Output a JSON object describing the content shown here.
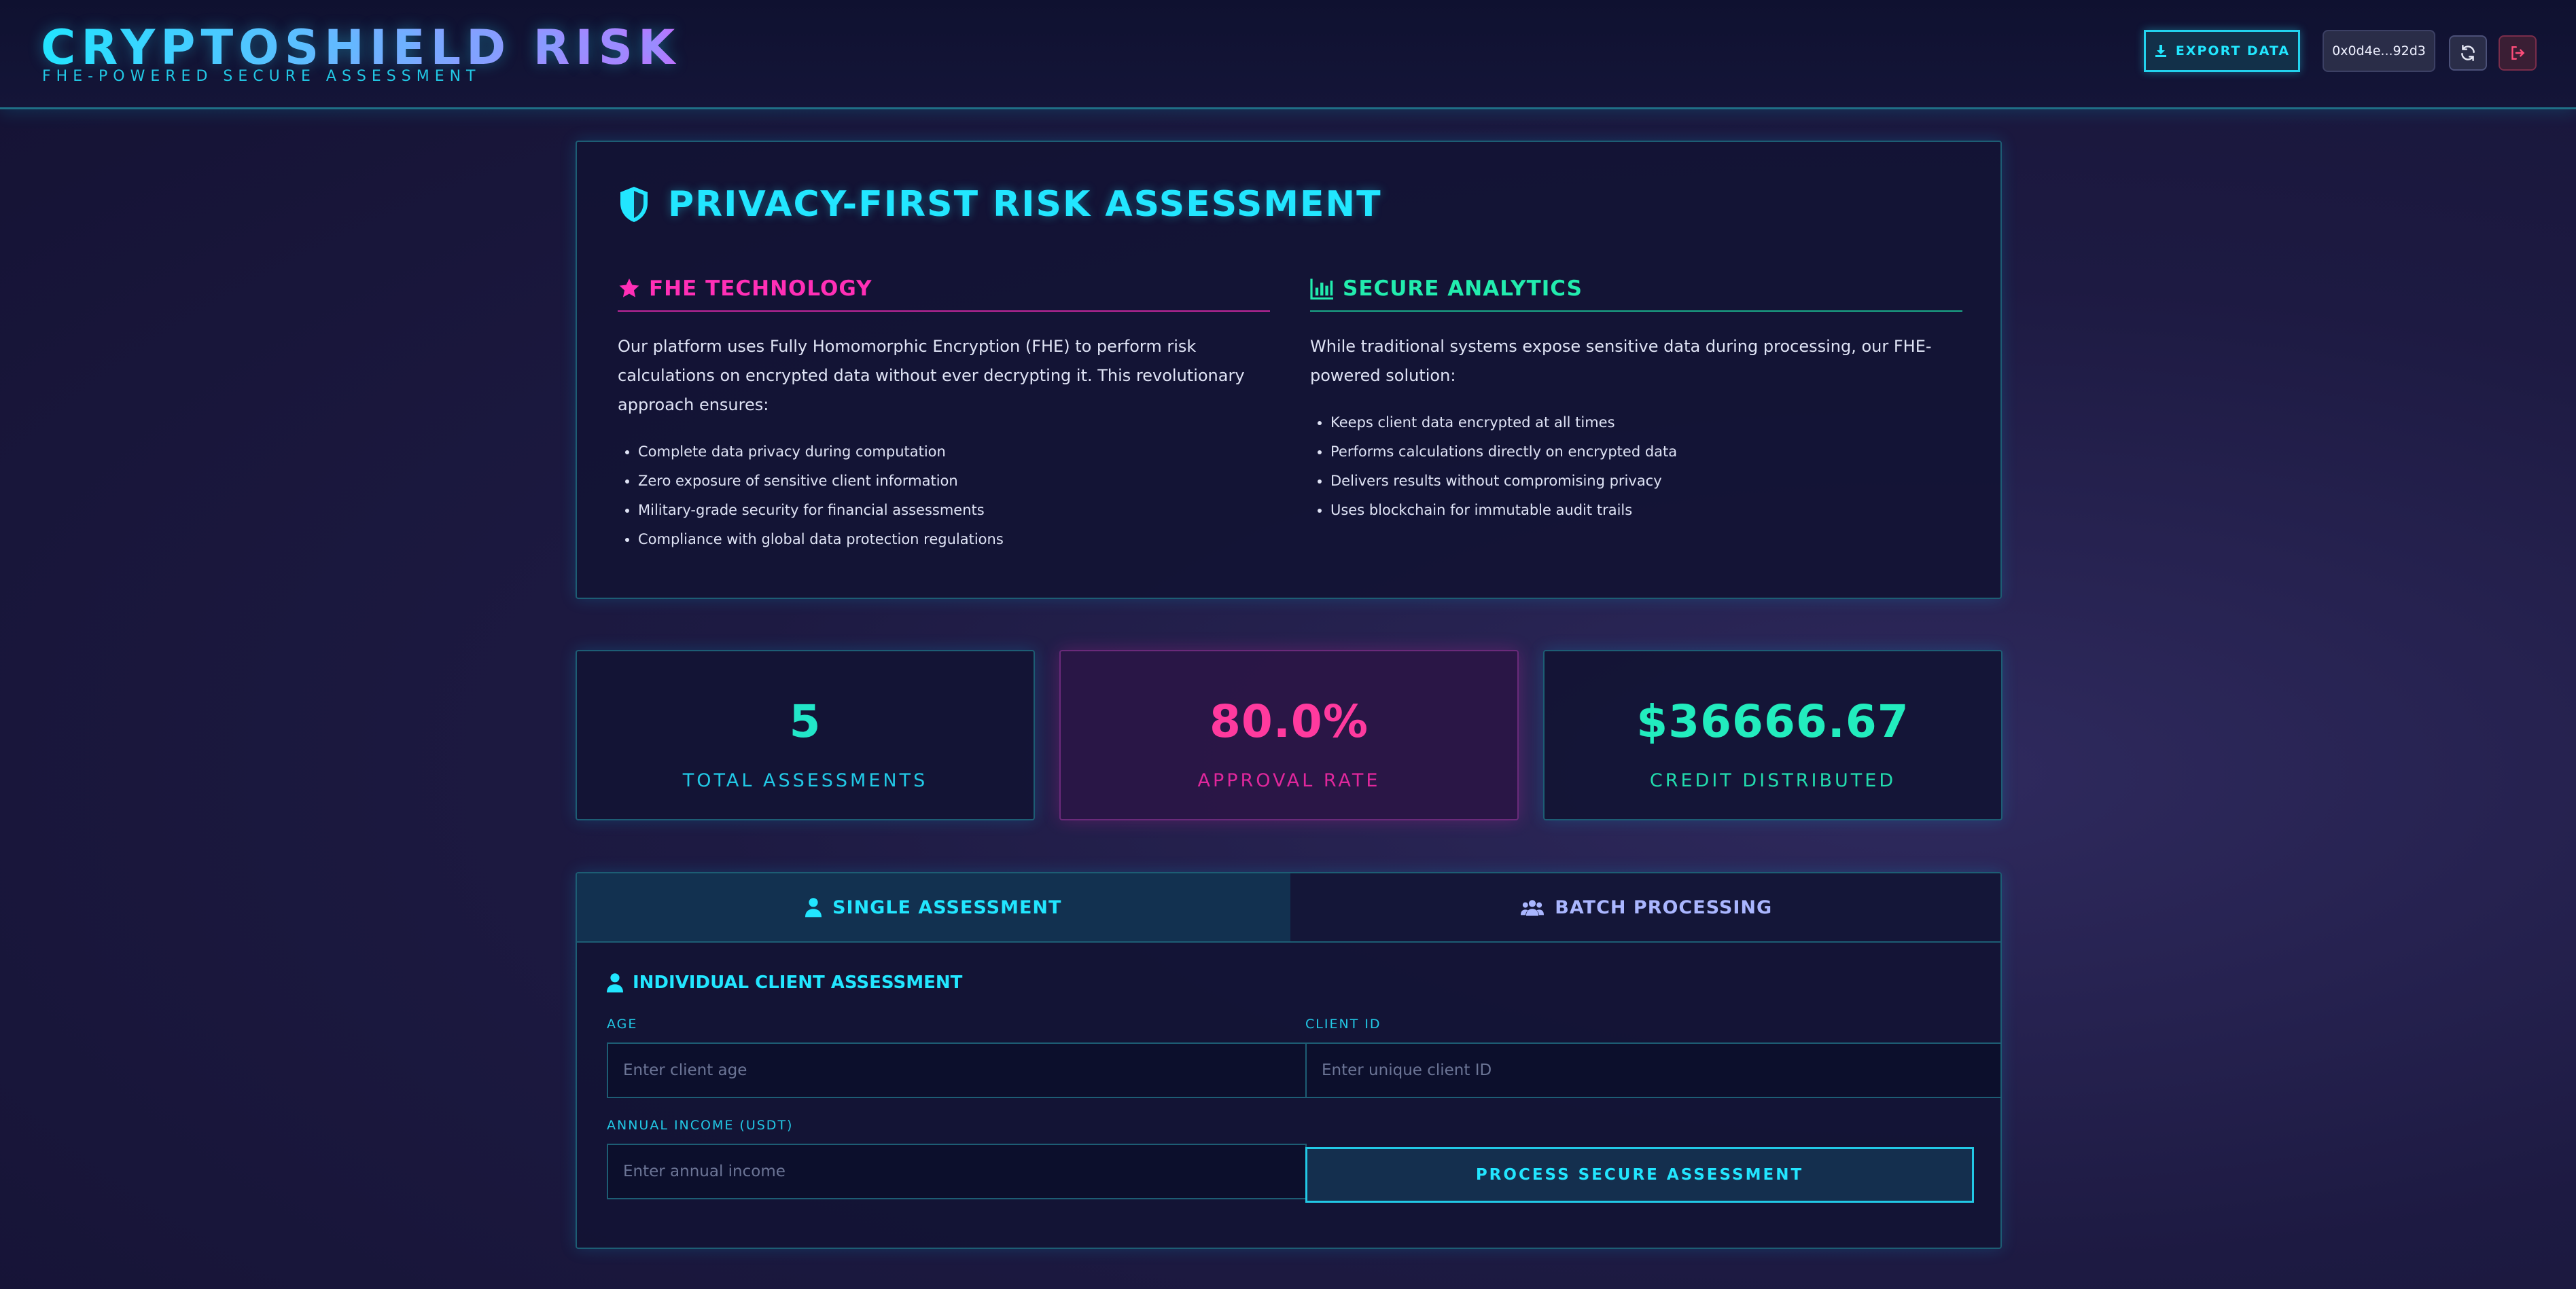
{
  "header": {
    "title": "CRYPTOSHIELD RISK",
    "tagline": "FHE-POWERED SECURE ASSESSMENT",
    "export_label": "EXPORT DATA",
    "wallet": "0x0d4e...92d3"
  },
  "intro": {
    "title": "PRIVACY-FIRST RISK ASSESSMENT",
    "fhe": {
      "heading": "FHE TECHNOLOGY",
      "text": "Our platform uses Fully Homomorphic Encryption (FHE) to perform risk calculations on encrypted data without ever decrypting it. This revolutionary approach ensures:",
      "items": [
        "Complete data privacy during computation",
        "Zero exposure of sensitive client information",
        "Military-grade security for financial assessments",
        "Compliance with global data protection regulations"
      ]
    },
    "analytics": {
      "heading": "SECURE ANALYTICS",
      "text": "While traditional systems expose sensitive data during processing, our FHE-powered solution:",
      "items": [
        "Keeps client data encrypted at all times",
        "Performs calculations directly on encrypted data",
        "Delivers results without compromising privacy",
        "Uses blockchain for immutable audit trails"
      ]
    }
  },
  "stats": [
    {
      "value": "5",
      "label": "TOTAL ASSESSMENTS"
    },
    {
      "value": "80.0%",
      "label": "APPROVAL RATE"
    },
    {
      "value": "$36666.67",
      "label": "CREDIT DISTRIBUTED"
    }
  ],
  "tabs": {
    "single": "SINGLE ASSESSMENT",
    "batch": "BATCH PROCESSING"
  },
  "form": {
    "title": "INDIVIDUAL CLIENT ASSESSMENT",
    "age_label": "AGE",
    "age_placeholder": "Enter client age",
    "client_id_label": "CLIENT ID",
    "client_id_placeholder": "Enter unique client ID",
    "income_label": "ANNUAL INCOME (USDT)",
    "income_placeholder": "Enter annual income",
    "submit_label": "PROCESS SECURE ASSESSMENT"
  },
  "colors": {
    "accent_cyan": "#22e6ff",
    "accent_pink": "#ff2fb6",
    "accent_green": "#22ecae"
  }
}
